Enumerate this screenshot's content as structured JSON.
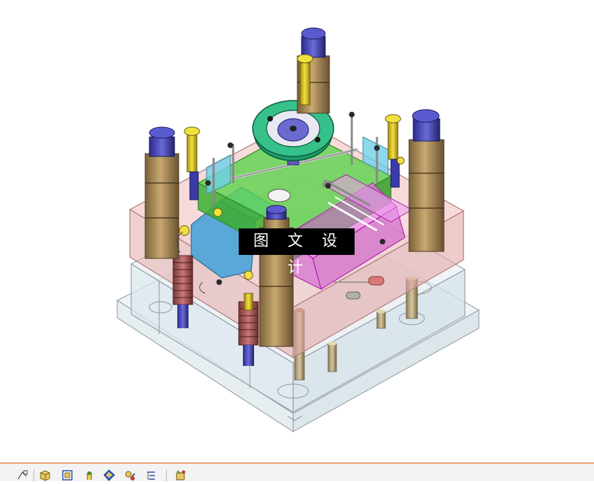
{
  "watermark": {
    "text": "图 文 设 计"
  },
  "toolbar": {
    "icons": [
      "sketch-icon",
      "part-icon",
      "assembly-icon",
      "feature-icon",
      "shaded-view-icon",
      "edit-component-icon",
      "hierarchy-icon",
      "rebuild-icon"
    ]
  },
  "colors": {
    "plate_pink": "#e8b4b4",
    "plate_clear": "#dce8ee",
    "cavity_blue": "#5aa8d8",
    "core_green": "#46c43a",
    "slider_magenta": "#e060e0",
    "ring_teal": "#20a070",
    "pillar_tan": "#a88a58",
    "bolt_yellow": "#e8d020",
    "bushing_navy": "#3a3aa8",
    "toolbar_accent": "#e8a070"
  }
}
